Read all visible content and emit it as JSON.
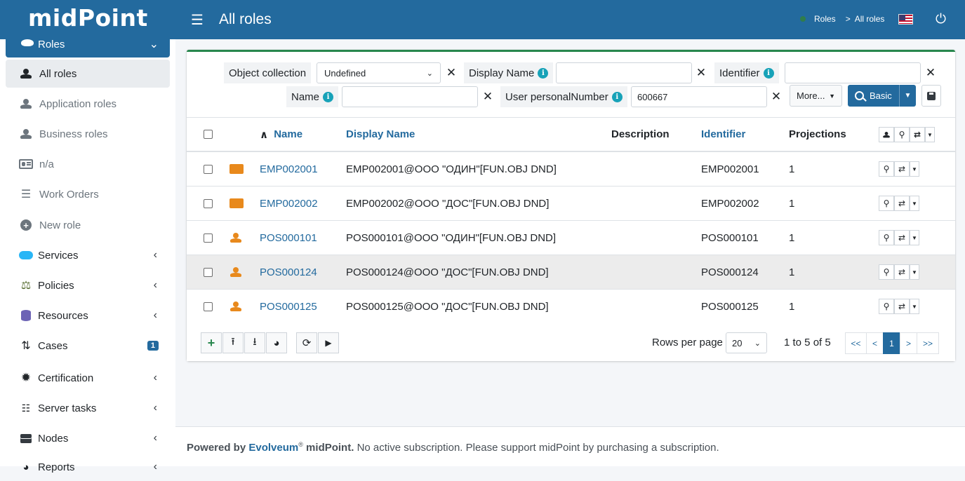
{
  "header": {
    "logo": "midPoint",
    "title": "All roles",
    "breadcrumb": [
      "Roles",
      ">",
      "All roles"
    ]
  },
  "sidebar": {
    "roles_label": "Roles",
    "sub": [
      {
        "label": "All roles",
        "icon": "person-icon",
        "active": true
      },
      {
        "label": "Application roles",
        "icon": "person-icon"
      },
      {
        "label": "Business roles",
        "icon": "person-icon"
      },
      {
        "label": "n/a",
        "icon": "id-card-icon"
      },
      {
        "label": "Work Orders",
        "icon": "list-icon"
      },
      {
        "label": "New role",
        "icon": "plus-circle-icon"
      }
    ],
    "main": [
      {
        "label": "Services",
        "icon": "cloud-icon",
        "color": "#29b6f6"
      },
      {
        "label": "Policies",
        "icon": "balance-scale-icon",
        "color": "#556b2f"
      },
      {
        "label": "Resources",
        "icon": "database-icon",
        "color": "#6c63b5"
      },
      {
        "label": "Cases",
        "icon": "cases-icon",
        "badge": "1"
      },
      {
        "label": "Certification",
        "icon": "certificate-icon"
      },
      {
        "label": "Server tasks",
        "icon": "tasks-icon"
      },
      {
        "label": "Nodes",
        "icon": "server-icon"
      },
      {
        "label": "Reports",
        "icon": "pie-chart-icon"
      }
    ]
  },
  "filters": {
    "object_collection_label": "Object collection",
    "object_collection_value": "Undefined",
    "display_name_label": "Display Name",
    "display_name_value": "",
    "identifier_label": "Identifier",
    "identifier_value": "",
    "name_label": "Name",
    "name_value": "",
    "personal_number_label": "User personalNumber",
    "personal_number_value": "600667",
    "more_label": "More...",
    "basic_label": "Basic",
    "info": "i",
    "clear": "✕"
  },
  "table": {
    "headers": {
      "name": "Name",
      "display_name": "Display Name",
      "description": "Description",
      "identifier": "Identifier",
      "projections": "Projections"
    },
    "rows": [
      {
        "name": "EMP002001",
        "display_name": "EMP002001@ООО \"ОДИН\"[FUN.OBJ DND]",
        "description": "",
        "identifier": "EMP002001",
        "projections": "1",
        "icon": "id-card-icon"
      },
      {
        "name": "EMP002002",
        "display_name": "EMP002002@ООО \"ДОС\"[FUN.OBJ DND]",
        "description": "",
        "identifier": "EMP002002",
        "projections": "1",
        "icon": "id-card-icon"
      },
      {
        "name": "POS000101",
        "display_name": "POS000101@ООО \"ОДИН\"[FUN.OBJ DND]",
        "description": "",
        "identifier": "POS000101",
        "projections": "1",
        "icon": "user-tie-icon"
      },
      {
        "name": "POS000124",
        "display_name": "POS000124@ООО \"ДОС\"[FUN.OBJ DND]",
        "description": "",
        "identifier": "POS000124",
        "projections": "1",
        "icon": "user-tie-icon"
      },
      {
        "name": "POS000125",
        "display_name": "POS000125@ООО \"ДОС\"[FUN.OBJ DND]",
        "description": "",
        "identifier": "POS000125",
        "projections": "1",
        "icon": "user-tie-icon"
      }
    ]
  },
  "pagination": {
    "rows_per_page_label": "Rows per page",
    "rows_per_page": "20",
    "range": "1 to 5 of 5",
    "pages": [
      "<<",
      "<",
      "1",
      ">",
      ">>"
    ]
  },
  "footer": {
    "powered": "Powered by",
    "evolveum": "Evolveum",
    "reg": "®",
    "midpoint": " midPoint.",
    "message": "No active subscription. Please support midPoint by purchasing a subscription."
  },
  "colors": {
    "header": "#236a9e",
    "accent": "#28874e",
    "role_icon": "#e8891c"
  }
}
